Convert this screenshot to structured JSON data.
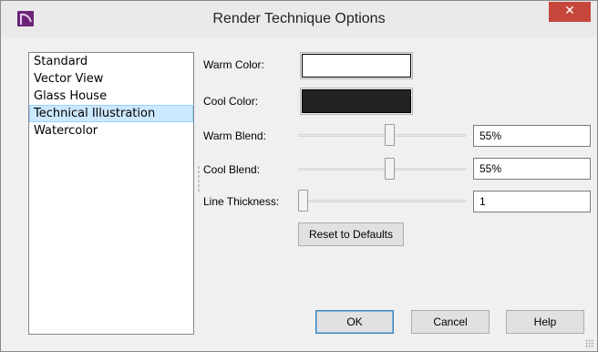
{
  "window": {
    "title": "Render Technique Options",
    "close_glyph": "✕"
  },
  "techniques": [
    {
      "label": "Standard",
      "selected": false
    },
    {
      "label": "Vector View",
      "selected": false
    },
    {
      "label": "Glass House",
      "selected": false
    },
    {
      "label": "Technical Illustration",
      "selected": true
    },
    {
      "label": "Watercolor",
      "selected": false
    }
  ],
  "settings": {
    "warm_color_label": "Warm Color:",
    "warm_color_value": "#ffffff",
    "cool_color_label": "Cool Color:",
    "cool_color_value": "#222222",
    "warm_blend_label": "Warm Blend:",
    "warm_blend_value": "55%",
    "warm_blend_fraction": 0.55,
    "cool_blend_label": "Cool Blend:",
    "cool_blend_value": "55%",
    "cool_blend_fraction": 0.55,
    "line_thickness_label": "Line Thickness:",
    "line_thickness_value": "1",
    "line_thickness_fraction": 0.0,
    "reset_label": "Reset to Defaults"
  },
  "footer": {
    "ok_label": "OK",
    "cancel_label": "Cancel",
    "help_label": "Help"
  },
  "colors": {
    "selection_bg": "#cce8ff",
    "close_button": "#c7463b",
    "app_icon": "#6a2478"
  }
}
